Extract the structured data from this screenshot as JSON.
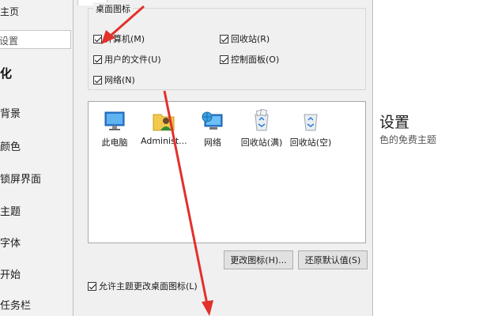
{
  "left_panel": {
    "home": "主页",
    "search_placeholder": "设置",
    "section_title": "化",
    "items": [
      {
        "label": "背景"
      },
      {
        "label": "颜色"
      },
      {
        "label": "锁屏界面"
      },
      {
        "label": "主题"
      },
      {
        "label": "字体"
      },
      {
        "label": "开始"
      },
      {
        "label": "任务栏"
      }
    ]
  },
  "background": {
    "heading": "设置",
    "subtext": "色的免费主题"
  },
  "dialog": {
    "group_title": "桌面图标",
    "checkboxes": [
      {
        "label": "计算机(M)",
        "checked": true
      },
      {
        "label": "回收站(R)",
        "checked": true
      },
      {
        "label": "用户的文件(U)",
        "checked": true
      },
      {
        "label": "控制面板(O)",
        "checked": true
      },
      {
        "label": "网络(N)",
        "checked": true
      }
    ],
    "icons": [
      {
        "label": "此电脑",
        "icon": "computer-icon"
      },
      {
        "label": "Administ...",
        "icon": "user-folder-icon"
      },
      {
        "label": "网络",
        "icon": "network-icon"
      },
      {
        "label": "回收站(满)",
        "icon": "recycle-bin-full-icon"
      },
      {
        "label": "回收站(空)",
        "icon": "recycle-bin-empty-icon"
      }
    ],
    "change_icon_button": "更改图标(H)...",
    "restore_default_button": "还原默认值(S)",
    "allow_themes_label": "允许主题更改桌面图标(L)",
    "allow_themes_checked": true
  },
  "colors": {
    "annotation_arrow": "#e2302b",
    "dialog_bg": "#f0f0f0",
    "left_panel_bg": "#f2f2f2"
  }
}
